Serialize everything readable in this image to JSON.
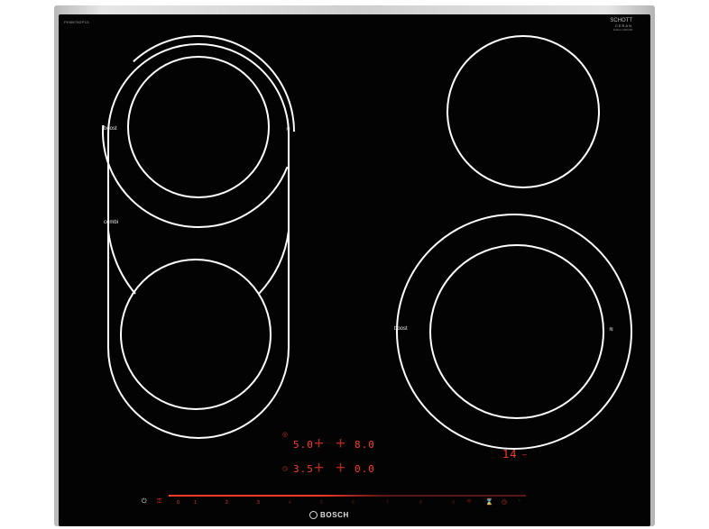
{
  "appliance": {
    "model": "PKM875DP1D",
    "top_right_brand": {
      "line1": "SCHOTT",
      "line2": "CERAN",
      "sub": "Edition 2021/08"
    },
    "brand": "BOSCH"
  },
  "zones": {
    "left_boost_label": "boost",
    "left_combi_label": "combi",
    "right_boost_label": "boost",
    "boost_marker": "≋"
  },
  "display": {
    "row1_left": "5.0",
    "row1_right": "8.0",
    "row2_left": "3.5",
    "row2_right": "0.0",
    "timer": "14",
    "timer_suffix": "–"
  },
  "slider": {
    "levels": [
      "0",
      "1",
      "2",
      "3",
      "4",
      "5",
      "6",
      "7",
      "8",
      "9"
    ]
  },
  "icons": {
    "power": "power-icon",
    "lock": "child-lock-icon",
    "timer": "timer-icon",
    "clock": "clock-icon"
  },
  "colors": {
    "glass": "#030303",
    "accent_red": "#ff3a2a"
  }
}
